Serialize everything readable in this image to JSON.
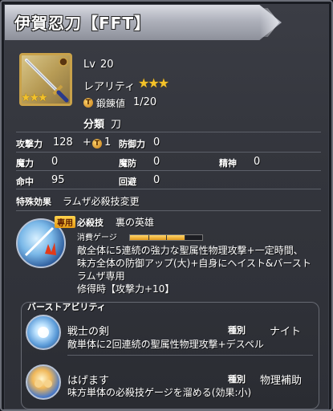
{
  "title": "伊賀忍刀【FFT】",
  "equip": {
    "icon_rarity_stars": "★★★",
    "level_label": "Lv",
    "level_value": "20",
    "rarity_label": "レアリティ",
    "rarity_stars": "★★★",
    "forge_label": "鍛錬値",
    "forge_value": "1/20",
    "category_label": "分類",
    "category_value": "刀"
  },
  "stats": {
    "atk_label": "攻撃力",
    "atk_value": "128",
    "atk_bonus": "+",
    "atk_bonus_value": "1",
    "def_label": "防御力",
    "def_value": "0",
    "mag_label": "魔力",
    "mag_value": "0",
    "mdef_label": "魔防",
    "mdef_value": "0",
    "spr_label": "精神",
    "spr_value": "0",
    "acc_label": "命中",
    "acc_value": "95",
    "eva_label": "回避",
    "eva_value": "0"
  },
  "special": {
    "label": "特殊効果",
    "value": "ラムザ必殺技変更"
  },
  "ultimate": {
    "exclusive_badge": "専用",
    "type_label": "必殺技",
    "name": "裏の英雄",
    "gauge_label": "消費ゲージ",
    "gauge_fill": 0.75,
    "desc_line1": "敵全体に5連続の強力な聖属性物理攻撃+一定時間、",
    "desc_line2": "味方全体の防御アップ(大)+自身にヘイスト&バースト",
    "exclusive_note": "ラムザ専用",
    "mastery": "修得時【攻撃力+10】"
  },
  "burst": {
    "header": "バーストアビリティ",
    "abilities": [
      {
        "name": "戦士の剣",
        "kind_label": "種別",
        "kind": "ナイト",
        "desc": "敵単体に2回連続の聖属性物理攻撃+デスペル"
      },
      {
        "name": "はげます",
        "kind_label": "種別",
        "kind": "物理補助",
        "desc": "味方単体の必殺技ゲージを溜める(効果:小)"
      }
    ]
  },
  "icons": {
    "weapon": "katana-icon",
    "coin": "forge-coin-icon",
    "ultimate": "ultimate-skill-icon",
    "ability1": "warrior-sword-icon",
    "ability2": "encourage-icon"
  },
  "colors": {
    "star": "#f3c22a",
    "badge": "#e59a14",
    "frame": "#6b6e78"
  }
}
